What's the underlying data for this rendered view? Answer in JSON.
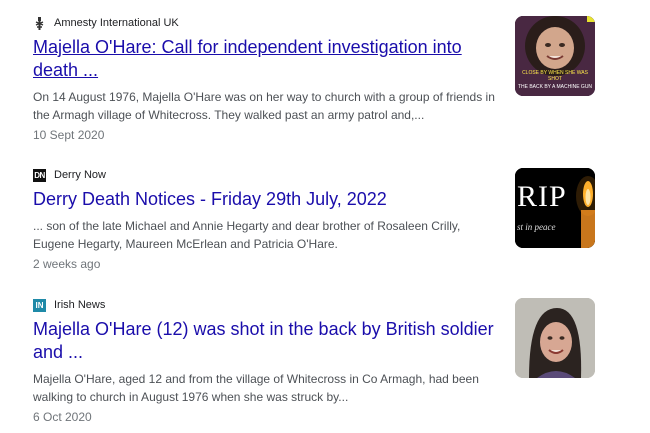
{
  "results": [
    {
      "source": "Amnesty International UK",
      "favicon": "amnesty-candle-icon",
      "title": "Majella O'Hare: Call for independent investigation into death ...",
      "snippet": "On 14 August 1976, Majella O'Hare was on her way to church with a group of friends in the Armagh village of Whitecross. They walked past an army patrol and,...",
      "date": "10 Sept 2020",
      "thumb_caption_1": "CLOSE BY WHEN SHE WAS SHOT",
      "thumb_caption_2": "THE BACK BY A MACHINE GUN"
    },
    {
      "source": "Derry Now",
      "favicon_text": "DN",
      "title": "Derry Death Notices - Friday 29th July, 2022",
      "snippet": "... son of the late Michael and Annie Hegarty and dear brother of Rosaleen Crilly, Eugene Hegarty, Maureen McErlean and Patricia O'Hare.",
      "date": "2 weeks ago",
      "thumb_big": "RIP",
      "thumb_small": "st in peace"
    },
    {
      "source": "Irish News",
      "favicon_text": "IN",
      "title": "Majella O'Hare (12) was shot in the back by British soldier and ...",
      "snippet": "Majella O'Hare, aged 12 and from the village of Whitecross in Co Armagh, had been walking to church in August 1976 when she was struck by...",
      "date": "6 Oct 2020"
    }
  ],
  "colors": {
    "link": "#1a0dab",
    "snippet": "#4d5156",
    "date": "#70757a"
  }
}
